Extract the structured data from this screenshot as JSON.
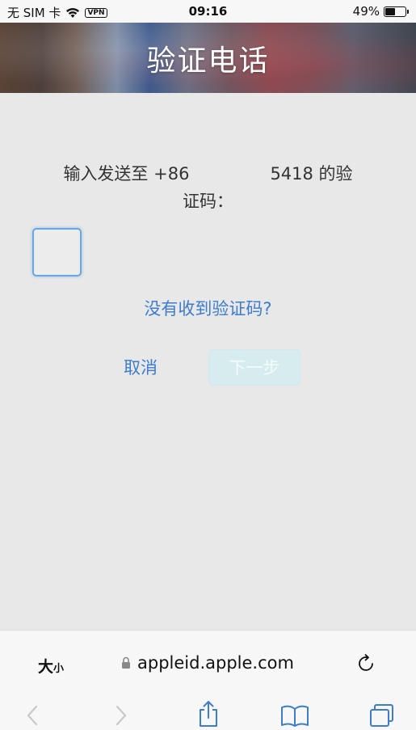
{
  "status_bar": {
    "carrier": "无 SIM 卡",
    "vpn": "VPN",
    "time": "09:16",
    "battery_percent_text": "49%",
    "battery_level": 0.49
  },
  "header": {
    "title": "验证电话"
  },
  "main": {
    "prompt_prefix": "输入发送至 +86",
    "prompt_suffix": "5418 的验",
    "prompt_line2": "证码：",
    "resend_link": "没有收到验证码?",
    "cancel_label": "取消",
    "next_label": "下一步"
  },
  "browser": {
    "text_size_big": "大",
    "text_size_small": "小",
    "url": "appleid.apple.com"
  },
  "colors": {
    "link": "#3d7ccf",
    "input_focus": "#6aa6e0",
    "next_disabled_bg": "#d6ecef"
  }
}
